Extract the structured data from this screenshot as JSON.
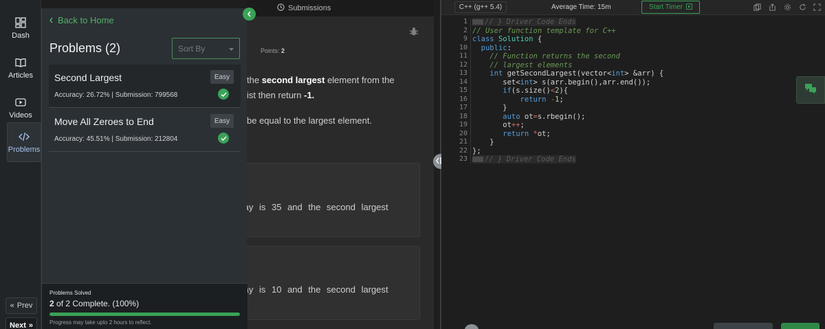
{
  "rail": {
    "items": [
      {
        "label": "Dash",
        "icon": "dashboard-icon"
      },
      {
        "label": "Articles",
        "icon": "book-icon"
      },
      {
        "label": "Videos",
        "icon": "play-icon"
      },
      {
        "label": "Problems",
        "icon": "code-icon"
      }
    ],
    "prev_label": "Prev",
    "next_label": "Next"
  },
  "panel": {
    "back_label": "Back to Home",
    "title": "Problems (2)",
    "sort_placeholder": "Sort By",
    "problems": [
      {
        "name": "Second Largest",
        "difficulty": "Easy",
        "meta": "Accuracy: 26.72% | Submission: 799568"
      },
      {
        "name": "Move All Zeroes to End",
        "difficulty": "Easy",
        "meta": "Accuracy: 45.51% | Submission: 212804"
      }
    ],
    "progress": {
      "label": "Problems Solved",
      "solved": "2",
      "count_rest": " of 2 Complete. (100%)",
      "fraction": 1.0,
      "note": "Progress may take upto 2 hours to reflect."
    }
  },
  "statement": {
    "submissions_label": "Submissions",
    "points_label": "Points:",
    "points_value": "2",
    "line1_pre": "the ",
    "line1_bold": "second largest",
    "line1_post": " element from the",
    "line2_pre": "ist then return ",
    "line2_bold": "-1.",
    "line3": "be equal to the largest element.",
    "example1": "rray is 35 and the second largest",
    "example2": "rray is 10 and the second largest"
  },
  "editor": {
    "language": "C++ (g++ 5.4)",
    "avg_time": "Average Time: 15m",
    "start_timer": "Start Timer",
    "line_numbers": [
      "1",
      "2",
      "9",
      "10",
      "11",
      "12",
      "13",
      "14",
      "15",
      "16",
      "17",
      "18",
      "19",
      "20",
      "21",
      "22",
      "23"
    ]
  },
  "colors": {
    "accent_green": "#3aa257",
    "panel_bg": "#2b3034",
    "editor_bg": "#1e1e1e"
  }
}
